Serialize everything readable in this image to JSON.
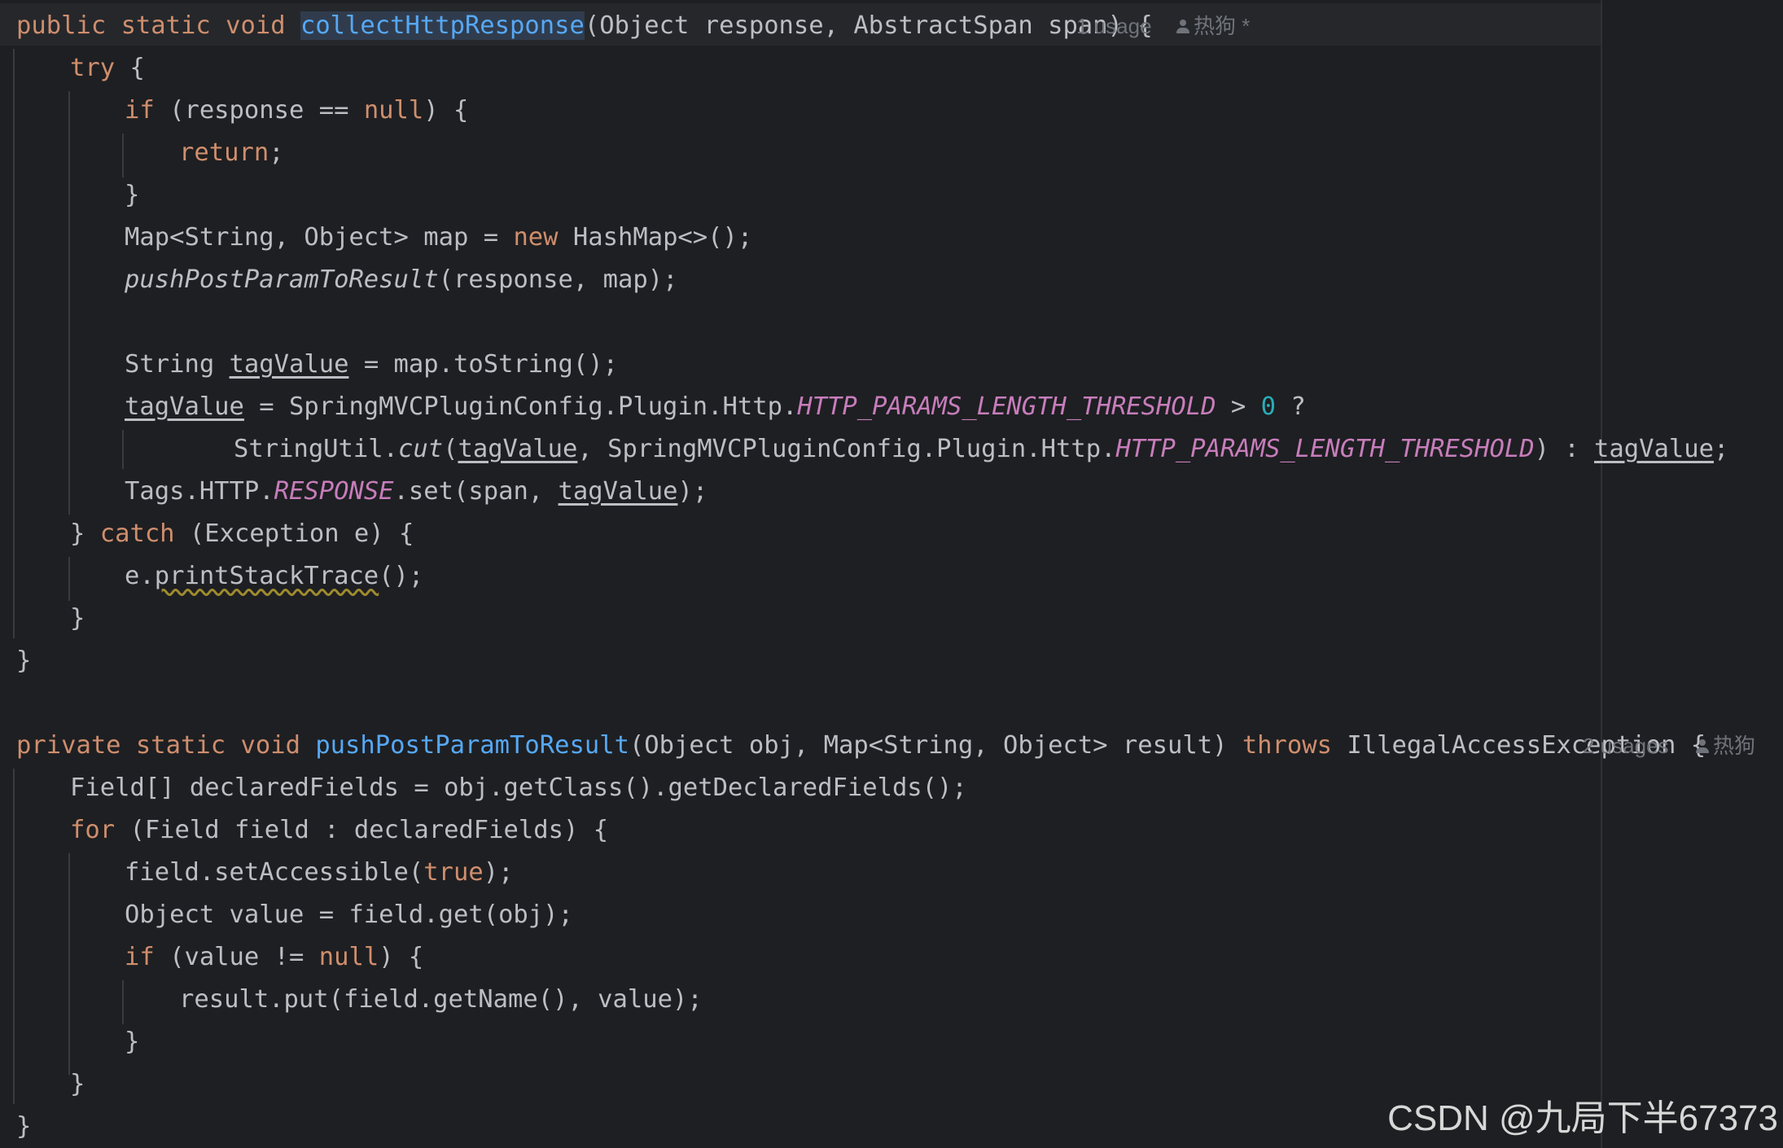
{
  "editor": {
    "method1": {
      "signature": {
        "kw1": "public",
        "kw2": "static",
        "kw3": "void",
        "name": "collectHttpResponse",
        "params": "(Object response, AbstractSpan span) {"
      },
      "usage_hint": "1 usage",
      "author_hint": "热狗 *",
      "try_kw": "try",
      "try_brace": " {",
      "if_kw": "if",
      "if_open": " (response == ",
      "null_kw": "null",
      "if_close": ") {",
      "return_kw": "return",
      "return_semi": ";",
      "close1": "}",
      "map_decl_a": "Map<String, Object> map = ",
      "new_kw": "new",
      "map_decl_b": " HashMap<>();",
      "push_call_name": "pushPostParamToResult",
      "push_call_args": "(response, map);",
      "string_decl_a": "String ",
      "tag_var": "tagValue",
      "string_decl_b": " = map.toString();",
      "assign_b": " = SpringMVCPluginConfig.Plugin.Http.",
      "threshold_const": "HTTP_PARAMS_LENGTH_THRESHOLD",
      "assign_c": " > ",
      "zero": "0",
      "assign_d": " ?",
      "cut_a": "StringUtil.",
      "cut_fn": "cut",
      "cut_b": "(",
      "cut_c": ", SpringMVCPluginConfig.Plugin.Http.",
      "cut_d": ") : ",
      "cut_e": ";",
      "tags_a": "Tags.HTTP.",
      "response_const": "RESPONSE",
      "tags_b": ".set(span, ",
      "tags_c": ");",
      "catch_close": "} ",
      "catch_kw": "catch",
      "catch_b": " (Exception e) {",
      "e_a": "e.",
      "print_fn": "printStackTrace",
      "e_b": "();",
      "close2": "}",
      "close3": "}"
    },
    "method2": {
      "signature": {
        "kw1": "private",
        "kw2": "static",
        "kw3": "void",
        "name": "pushPostParamToResult",
        "params_a": "(Object obj, Map<String, Object> result) ",
        "throws_kw": "throws",
        "params_b": " IllegalAccessException {"
      },
      "usage_hint": "2 usages",
      "author_hint": "热狗",
      "fields_decl": "Field[] declaredFields = obj.getClass().getDeclaredFields();",
      "for_kw": "for",
      "for_b": " (Field field : declaredFields) {",
      "set_a": "field.setAccessible(",
      "true_kw": "true",
      "set_b": ");",
      "obj_decl": "Object value = field.get(obj);",
      "if_kw": "if",
      "if_b": " (value != ",
      "null_kw": "null",
      "if_c": ") {",
      "put_line": "result.put(field.getName(), value);",
      "close1": "}",
      "close2": "}",
      "close3": "}"
    }
  },
  "watermark": "CSDN @九局下半67373",
  "colors": {
    "background": "#1e1f22",
    "keyword": "#cf8e6d",
    "function": "#56a8f5",
    "constant": "#c77dbb",
    "number": "#2aacb8",
    "text": "#bcbec4",
    "hint": "#6f737a"
  }
}
